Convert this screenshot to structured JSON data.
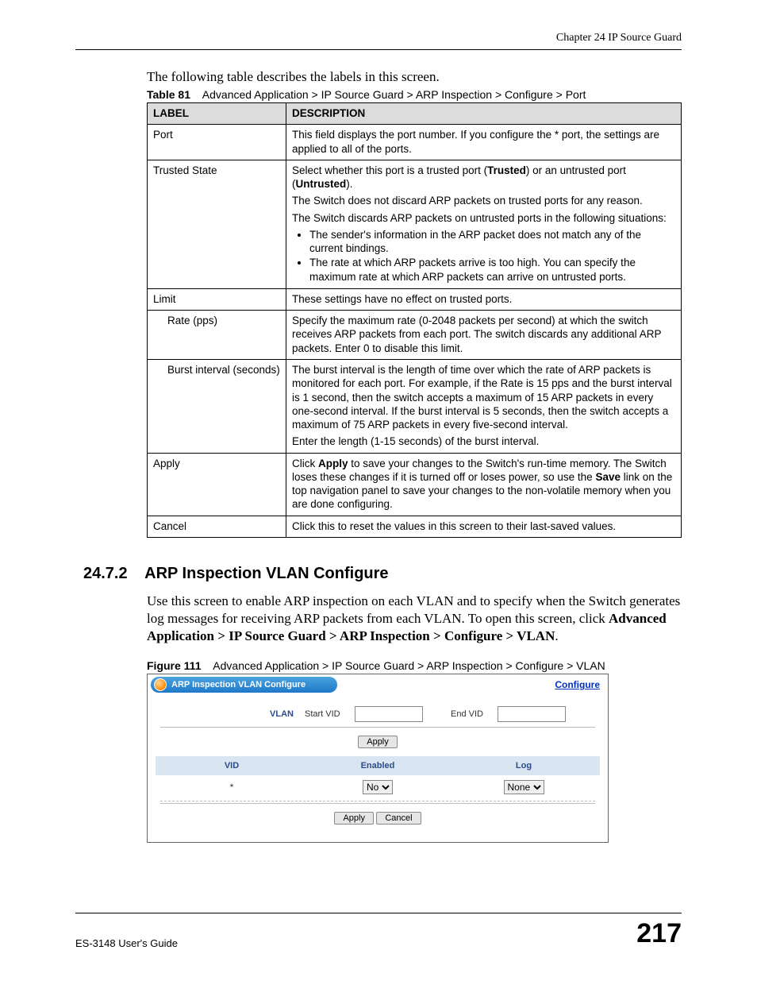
{
  "header": {
    "chapter": "Chapter 24 IP Source Guard"
  },
  "intro": "The following table describes the labels in this screen.",
  "table_caption": {
    "prefix": "Table 81",
    "path": "Advanced Application > IP Source Guard > ARP Inspection > Configure > Port"
  },
  "table": {
    "headers": {
      "label": "LABEL",
      "description": "DESCRIPTION"
    },
    "rows": [
      {
        "label": "Port",
        "desc": [
          {
            "type": "p",
            "runs": [
              {
                "t": "This field displays the port number. If you configure the * port, the settings are applied to all of the ports."
              }
            ]
          }
        ]
      },
      {
        "label": "Trusted State",
        "desc": [
          {
            "type": "p",
            "runs": [
              {
                "t": "Select whether this port is a trusted port ("
              },
              {
                "t": "Trusted",
                "b": true
              },
              {
                "t": ") or an untrusted port ("
              },
              {
                "t": "Untrusted",
                "b": true
              },
              {
                "t": ")."
              }
            ]
          },
          {
            "type": "p",
            "runs": [
              {
                "t": "The Switch does not discard ARP packets on trusted ports for any reason."
              }
            ]
          },
          {
            "type": "p",
            "runs": [
              {
                "t": "The Switch discards ARP packets on untrusted ports in the following situations:"
              }
            ]
          },
          {
            "type": "ul",
            "items": [
              "The sender's information in the ARP packet does not match any of the current bindings.",
              "The rate at which ARP packets arrive is too high. You can specify the maximum rate at which ARP packets can arrive on untrusted ports."
            ]
          }
        ]
      },
      {
        "label": "Limit",
        "desc": [
          {
            "type": "p",
            "runs": [
              {
                "t": "These settings have no effect on trusted ports."
              }
            ]
          }
        ]
      },
      {
        "label": "Rate (pps)",
        "indent": true,
        "desc": [
          {
            "type": "p",
            "runs": [
              {
                "t": "Specify the maximum rate (0-2048 packets per second) at which the switch receives ARP packets from each port. The switch discards any additional ARP packets. Enter 0 to disable this limit."
              }
            ]
          }
        ]
      },
      {
        "label": "Burst interval (seconds)",
        "indent": true,
        "desc": [
          {
            "type": "p",
            "runs": [
              {
                "t": "The burst interval is the length of time over which the rate of ARP packets is monitored for each port. For example, if the Rate is 15 pps and the burst interval is 1 second, then the switch accepts a maximum of 15 ARP packets in every one-second interval. If the burst interval is 5 seconds, then the switch accepts a maximum of 75 ARP packets in every five-second interval."
              }
            ]
          },
          {
            "type": "p",
            "runs": [
              {
                "t": "Enter the length (1-15 seconds) of the burst interval."
              }
            ]
          }
        ]
      },
      {
        "label": "Apply",
        "desc": [
          {
            "type": "p",
            "runs": [
              {
                "t": "Click "
              },
              {
                "t": "Apply",
                "b": true
              },
              {
                "t": " to save your changes to the Switch's run-time memory. The Switch loses these changes if it is turned off or loses power, so use the "
              },
              {
                "t": "Save",
                "b": true
              },
              {
                "t": " link on the top navigation panel to save your changes to the non-volatile memory when you are done configuring."
              }
            ]
          }
        ]
      },
      {
        "label": "Cancel",
        "desc": [
          {
            "type": "p",
            "runs": [
              {
                "t": "Click this to reset the values in this screen to their last-saved values."
              }
            ]
          }
        ]
      }
    ]
  },
  "section": {
    "number": "24.7.2",
    "title": "ARP Inspection VLAN Configure",
    "para_runs": [
      {
        "t": "Use this screen to enable ARP inspection on each VLAN and to specify when the Switch generates log messages for receiving ARP packets from each VLAN. To open this screen, click "
      },
      {
        "t": "Advanced Application > IP Source Guard > ARP Inspection > Configure > VLAN",
        "b": true
      },
      {
        "t": "."
      }
    ]
  },
  "figure_caption": {
    "prefix": "Figure 111",
    "path": "Advanced Application > IP Source Guard > ARP Inspection > Configure > VLAN"
  },
  "screenshot": {
    "title": "ARP Inspection VLAN Configure",
    "configure_link": "Configure",
    "vlan_label": "VLAN",
    "start_vid": "Start VID",
    "end_vid": "End VID",
    "apply": "Apply",
    "cancel": "Cancel",
    "cols": {
      "vid": "VID",
      "enabled": "Enabled",
      "log": "Log"
    },
    "row": {
      "vid": "*",
      "enabled": "No",
      "log": "None"
    }
  },
  "footer": {
    "guide": "ES-3148 User's Guide",
    "page": "217"
  }
}
